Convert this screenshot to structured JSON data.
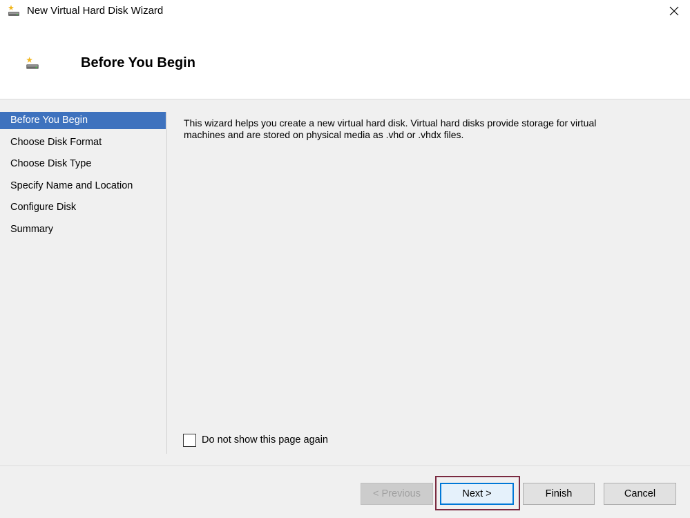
{
  "window": {
    "title": "New Virtual Hard Disk Wizard",
    "icon": "disk-wizard-icon",
    "close_icon": "close-icon"
  },
  "header": {
    "title": "Before You Begin",
    "icon": "disk-wizard-icon"
  },
  "nav": {
    "items": [
      {
        "label": "Before You Begin",
        "selected": true
      },
      {
        "label": "Choose Disk Format",
        "selected": false
      },
      {
        "label": "Choose Disk Type",
        "selected": false
      },
      {
        "label": "Specify Name and Location",
        "selected": false
      },
      {
        "label": "Configure Disk",
        "selected": false
      },
      {
        "label": "Summary",
        "selected": false
      }
    ]
  },
  "content": {
    "description_line1": "This wizard helps you create a new virtual hard disk. Virtual hard disks provide storage for virtual",
    "description_line2": "machines and are stored on physical media as .vhd or .vhdx files.",
    "checkbox_label": "Do not show this page again",
    "checkbox_checked": false
  },
  "buttons": {
    "previous": "< Previous",
    "next": "Next >",
    "finish": "Finish",
    "cancel": "Cancel"
  },
  "colors": {
    "selection": "#3e72be",
    "highlight": "#7a2a40",
    "focus": "#0078d7"
  }
}
